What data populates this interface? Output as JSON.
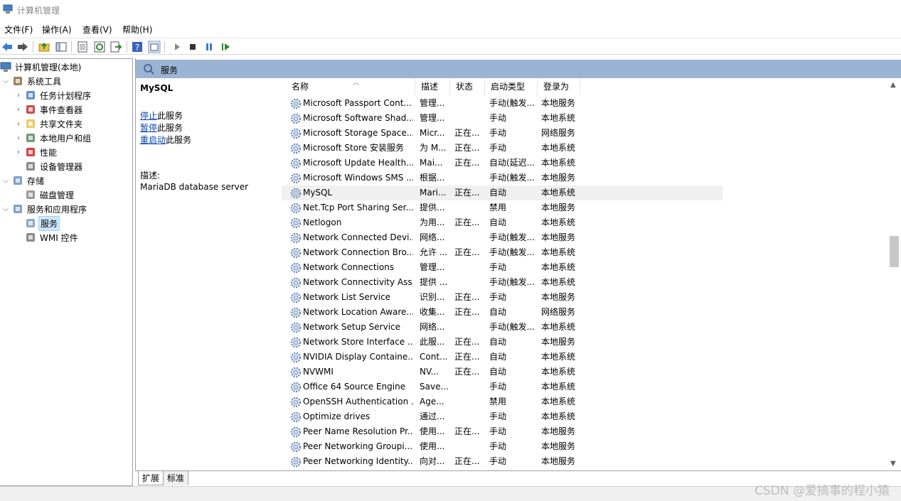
{
  "window": {
    "title": "计算机管理"
  },
  "menu": [
    "文件(F)",
    "操作(A)",
    "查看(V)",
    "帮助(H)"
  ],
  "toolbar_icons": [
    "back-icon",
    "forward-icon",
    "up-folder-icon",
    "show-hide-tree-icon",
    "properties-icon",
    "refresh-icon",
    "export-icon",
    "help-icon",
    "show-hide-action-icon",
    "start-icon",
    "stop-icon",
    "pause-icon",
    "resume-icon"
  ],
  "tree": {
    "root": "计算机管理(本地)",
    "items": [
      {
        "label": "系统工具",
        "level": 1,
        "expand": "open",
        "icon": "tools-icon"
      },
      {
        "label": "任务计划程序",
        "level": 2,
        "expand": "closed",
        "icon": "clock-icon"
      },
      {
        "label": "事件查看器",
        "level": 2,
        "expand": "closed",
        "icon": "event-viewer-icon"
      },
      {
        "label": "共享文件夹",
        "level": 2,
        "expand": "closed",
        "icon": "shared-folder-icon"
      },
      {
        "label": "本地用户和组",
        "level": 2,
        "expand": "closed",
        "icon": "users-icon"
      },
      {
        "label": "性能",
        "level": 2,
        "expand": "closed",
        "icon": "performance-icon"
      },
      {
        "label": "设备管理器",
        "level": 2,
        "expand": "none",
        "icon": "device-manager-icon"
      },
      {
        "label": "存储",
        "level": 1,
        "expand": "open",
        "icon": "storage-icon"
      },
      {
        "label": "磁盘管理",
        "level": 2,
        "expand": "none",
        "icon": "disk-icon"
      },
      {
        "label": "服务和应用程序",
        "level": 1,
        "expand": "open",
        "icon": "services-apps-icon"
      },
      {
        "label": "服务",
        "level": 2,
        "expand": "none",
        "icon": "services-icon",
        "selected": true
      },
      {
        "label": "WMI 控件",
        "level": 2,
        "expand": "none",
        "icon": "wmi-icon"
      }
    ]
  },
  "content": {
    "header_title": "服务",
    "detail": {
      "service_name": "MySQL",
      "actions": [
        {
          "link": "停止",
          "rest": "此服务"
        },
        {
          "link": "暂停",
          "rest": "此服务"
        },
        {
          "link": "重启动",
          "rest": "此服务"
        }
      ],
      "desc_label": "描述:",
      "description": "MariaDB database server"
    },
    "columns": [
      "名称",
      "描述",
      "状态",
      "启动类型",
      "登录为"
    ],
    "rows": [
      {
        "name": "Microsoft Passport Cont...",
        "desc": "管理...",
        "status": "",
        "startup": "手动(触发...",
        "logon": "本地服务"
      },
      {
        "name": "Microsoft Software Shad...",
        "desc": "管理...",
        "status": "",
        "startup": "手动",
        "logon": "本地系统"
      },
      {
        "name": "Microsoft Storage Space...",
        "desc": "Micr...",
        "status": "正在...",
        "startup": "手动",
        "logon": "网络服务"
      },
      {
        "name": "Microsoft Store 安装服务",
        "desc": "为 M...",
        "status": "正在...",
        "startup": "手动",
        "logon": "本地系统"
      },
      {
        "name": "Microsoft Update Health...",
        "desc": "Mai...",
        "status": "正在...",
        "startup": "自动(延迟...",
        "logon": "本地系统"
      },
      {
        "name": "Microsoft Windows SMS ...",
        "desc": "根据...",
        "status": "",
        "startup": "手动(触发...",
        "logon": "本地服务"
      },
      {
        "name": "MySQL",
        "desc": "Mari...",
        "status": "正在...",
        "startup": "自动",
        "logon": "本地系统",
        "selected": true
      },
      {
        "name": "Net.Tcp Port Sharing Ser...",
        "desc": "提供...",
        "status": "",
        "startup": "禁用",
        "logon": "本地服务"
      },
      {
        "name": "Netlogon",
        "desc": "为用...",
        "status": "正在...",
        "startup": "自动",
        "logon": "本地系统"
      },
      {
        "name": "Network Connected Devi...",
        "desc": "网络...",
        "status": "",
        "startup": "手动(触发...",
        "logon": "本地服务"
      },
      {
        "name": "Network Connection Bro...",
        "desc": "允许 ...",
        "status": "正在...",
        "startup": "手动(触发...",
        "logon": "本地系统"
      },
      {
        "name": "Network Connections",
        "desc": "管理...",
        "status": "",
        "startup": "手动",
        "logon": "本地系统"
      },
      {
        "name": "Network Connectivity Ass...",
        "desc": "提供 ...",
        "status": "",
        "startup": "手动(触发...",
        "logon": "本地系统"
      },
      {
        "name": "Network List Service",
        "desc": "识别...",
        "status": "正在...",
        "startup": "手动",
        "logon": "本地服务"
      },
      {
        "name": "Network Location Aware...",
        "desc": "收集...",
        "status": "正在...",
        "startup": "自动",
        "logon": "网络服务"
      },
      {
        "name": "Network Setup Service",
        "desc": "网络...",
        "status": "",
        "startup": "手动(触发...",
        "logon": "本地系统"
      },
      {
        "name": "Network Store Interface ...",
        "desc": "此服...",
        "status": "正在...",
        "startup": "自动",
        "logon": "本地服务"
      },
      {
        "name": "NVIDIA Display Containe...",
        "desc": "Cont...",
        "status": "正在...",
        "startup": "自动",
        "logon": "本地系统"
      },
      {
        "name": "NVWMI",
        "desc": "NV...",
        "status": "正在...",
        "startup": "自动",
        "logon": "本地系统"
      },
      {
        "name": "Office 64 Source Engine",
        "desc": "Save...",
        "status": "",
        "startup": "手动",
        "logon": "本地系统"
      },
      {
        "name": "OpenSSH Authentication ...",
        "desc": "Age...",
        "status": "",
        "startup": "禁用",
        "logon": "本地系统"
      },
      {
        "name": "Optimize drives",
        "desc": "通过...",
        "status": "",
        "startup": "手动",
        "logon": "本地系统"
      },
      {
        "name": "Peer Name Resolution Pr...",
        "desc": "使用...",
        "status": "正在...",
        "startup": "手动",
        "logon": "本地服务"
      },
      {
        "name": "Peer Networking Groupi...",
        "desc": "使用...",
        "status": "",
        "startup": "手动",
        "logon": "本地服务"
      },
      {
        "name": "Peer Networking Identity...",
        "desc": "向对...",
        "status": "正在...",
        "startup": "手动",
        "logon": "本地服务"
      }
    ]
  },
  "tabs": [
    "扩展",
    "标准"
  ],
  "watermark": "CSDN @爱搞事的程小猿"
}
